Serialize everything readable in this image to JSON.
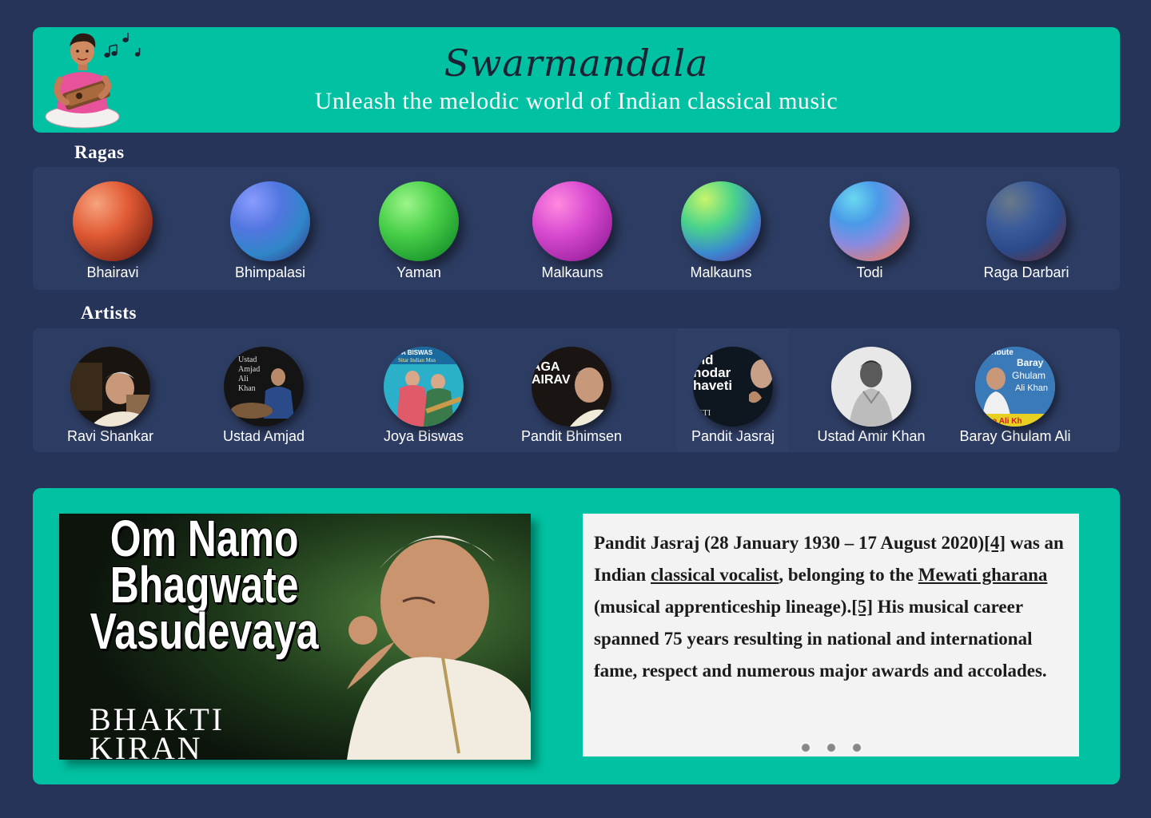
{
  "header": {
    "title": "Swarmandala",
    "tagline": "Unleash the melodic world of Indian classical music"
  },
  "ragas": {
    "heading": "Ragas",
    "items": [
      {
        "label": "Bhairavi",
        "color_a": "#f07a52",
        "color_b": "#8a2a18"
      },
      {
        "label": "Bhimpalasi",
        "color_a": "#6b8cf0",
        "color_b": "#1c4fb0"
      },
      {
        "label": "Yaman",
        "color_a": "#7af07a",
        "color_b": "#1a9a2a"
      },
      {
        "label": "Malkauns",
        "color_a": "#f07ae8",
        "color_b": "#a01ca0"
      },
      {
        "label": "Malkauns",
        "color_a": "#8af06a",
        "color_b": "#6a3ab0"
      },
      {
        "label": "Todi",
        "color_a": "#6ac8f0",
        "color_b": "#f07a5a"
      },
      {
        "label": "Raga Darbari",
        "color_a": "#4a6a9a",
        "color_b": "#7a2a3a"
      }
    ]
  },
  "artists": {
    "heading": "Artists",
    "items": [
      {
        "label": "Ravi Shankar"
      },
      {
        "label": "Ustad Amjad"
      },
      {
        "label": "Joya Biswas"
      },
      {
        "label": "Pandit Bhimsen"
      },
      {
        "label": "Pandit Jasraj"
      },
      {
        "label": "Ustad Amir Khan"
      },
      {
        "label": "Baray Ghulam Ali"
      }
    ],
    "photo_captions": {
      "amjad": [
        "Ustad",
        "Amjad",
        "Ali",
        "Khan"
      ],
      "joya": "A BISWAS",
      "joya_sub": "Sitar Indian Mus",
      "bhimsen": [
        "AGA",
        "AIRAV"
      ],
      "jasraj": [
        "ind",
        "nodar",
        "haveti"
      ],
      "jasraj_sub": "KTI",
      "ghulam": [
        "ribute",
        "Baray",
        "Ghulam",
        "Ali Khan"
      ],
      "ghulam_sub": "Raza Ali Kh"
    }
  },
  "feature": {
    "video_title": "Om Namo Bhagwate Vasudevaya",
    "video_brand": "BHAKTI KIRAN",
    "bio": {
      "part1": "Pandit Jasraj (28 January 1930 – 17 August 2020)",
      "ref1": "[4]",
      "part2": " was an Indian ",
      "link1": "classical vocalist",
      "part3": ", belonging to the ",
      "link2": "Mewati gharana",
      "part4": " (musical apprenticeship lineage).",
      "ref2": "[5]",
      "part5": " His musical career spanned 75 years resulting in national and international fame, respect and numerous major awards and accolades."
    },
    "carousel": {
      "count": 3
    }
  }
}
